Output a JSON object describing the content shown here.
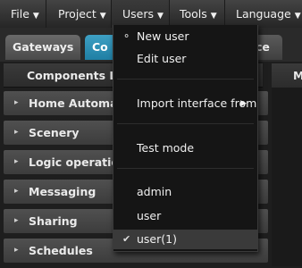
{
  "menubar": {
    "items": [
      {
        "label": "File"
      },
      {
        "label": "Project"
      },
      {
        "label": "Users"
      },
      {
        "label": "Tools"
      },
      {
        "label": "Language"
      }
    ],
    "arrow": "▼"
  },
  "tabs": [
    {
      "label": "Gateways"
    },
    {
      "label": "Co"
    },
    {
      "label": "ce"
    }
  ],
  "panel": {
    "title": "Components Lil",
    "right_title": "M"
  },
  "categories": [
    {
      "label": "Home Automat"
    },
    {
      "label": "Scenery"
    },
    {
      "label": "Logic operation"
    },
    {
      "label": "Messaging"
    },
    {
      "label": "Sharing"
    },
    {
      "label": "Schedules"
    }
  ],
  "users_menu": {
    "items": [
      {
        "label": "New user",
        "icon": "user-icon"
      },
      {
        "label": "Edit user"
      },
      {
        "label": "Import interface from",
        "submenu": true
      },
      {
        "label": "Test mode"
      },
      {
        "label": "admin"
      },
      {
        "label": "user"
      },
      {
        "label": "user(1)",
        "checked": true
      }
    ]
  },
  "icons": {
    "chevron": "▸",
    "submenu": "▶",
    "check": "✔",
    "user": "⚬"
  }
}
